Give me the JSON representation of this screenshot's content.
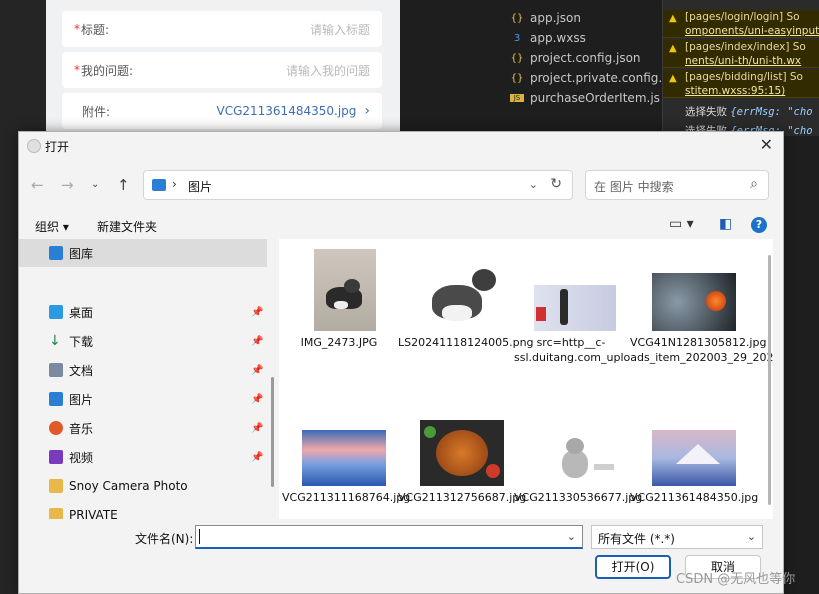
{
  "background_form": {
    "title_label": "标题:",
    "title_placeholder": "请输入标题",
    "question_label": "我的问题:",
    "question_placeholder": "请输入我的问题",
    "attachment_label": "附件:",
    "attachment_value": "VCG211361484350.jpg"
  },
  "background_files": [
    {
      "name": "app.json",
      "icon": "{}"
    },
    {
      "name": "app.wxss",
      "icon": "css"
    },
    {
      "name": "project.config.json",
      "icon": "{}"
    },
    {
      "name": "project.private.config.js...",
      "icon": "{}"
    },
    {
      "name": "purchaseOrderItem.js",
      "icon": "js"
    }
  ],
  "console": {
    "warnings": [
      {
        "prefix": "[pages/login/login] So",
        "link": "omponents/uni-easyinput"
      },
      {
        "prefix": "[pages/index/index] So",
        "link": "nents/uni-th/uni-th.wx"
      },
      {
        "prefix": "[pages/bidding/list] So",
        "link": "stitem.wxss:95:15)"
      }
    ],
    "lines": [
      {
        "label": "选择失败",
        "code": "{errMsg: \"cho"
      },
      {
        "label": "选择失败",
        "code": "{errMsg: \"cho"
      }
    ]
  },
  "dialog": {
    "title": "打开",
    "address": {
      "location": "图片"
    },
    "search_placeholder": "在 图片 中搜索",
    "toolbar": {
      "organize": "组织 ▾",
      "new_folder": "新建文件夹"
    },
    "nav": {
      "gallery": "图库",
      "items": [
        {
          "label": "桌面",
          "color": "#2a9be0"
        },
        {
          "label": "下载",
          "color": "#1a8a4a"
        },
        {
          "label": "文档",
          "color": "#7a8aa0"
        },
        {
          "label": "图片",
          "color": "#2a7fd4"
        },
        {
          "label": "音乐",
          "color": "#e05a2a"
        },
        {
          "label": "视频",
          "color": "#7a3ac0"
        },
        {
          "label": "Snoy Camera Photo",
          "color": "#e8b84a"
        },
        {
          "label": "PRIVATE",
          "color": "#e8b84a"
        }
      ]
    },
    "files": [
      {
        "name": "IMG_2473.JPG"
      },
      {
        "name": "LS20241118124005.png"
      },
      {
        "name": "src=http__c-ssl.duitang.com_uploads_item_202003_29_2020..."
      },
      {
        "name": "VCG41N1281305812.jpg"
      },
      {
        "name": "VCG211311168764.jpg"
      },
      {
        "name": "VCG211312756687.jpg"
      },
      {
        "name": "VCG211330536677.jpg"
      },
      {
        "name": "VCG211361484350.jpg"
      }
    ],
    "file_name_label": "文件名(N):",
    "file_name_value": "",
    "file_type": "所有文件 (*.*)",
    "open_button": "打开(O)",
    "cancel_button": "取消"
  },
  "watermark": "CSDN @无风也等你"
}
